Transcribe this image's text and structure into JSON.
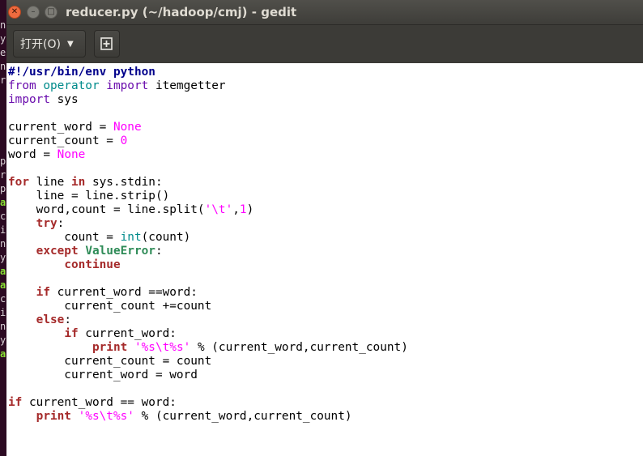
{
  "window": {
    "title": "reducer.py (~/hadoop/cmj) - gedit",
    "close_glyph": "✕",
    "min_glyph": "–",
    "max_glyph": "□"
  },
  "toolbar": {
    "open_label": "打开(O)",
    "open_caret": "▼"
  },
  "background_terminal": {
    "fragments": [
      "ne",
      "y",
      "er",
      "ne",
      "rt",
      "p",
      "r",
      "p",
      "ab",
      "co",
      "i",
      "n",
      "y",
      "ab",
      "ab",
      "co",
      "i",
      "n",
      "y",
      "ab"
    ]
  },
  "code": {
    "l1": "#!/usr/bin/env python",
    "l2_kw1": "from",
    "l2_mod": " operator ",
    "l2_kw2": "import",
    "l2_rest": " itemgetter",
    "l3_kw": "import",
    "l3_rest": " sys",
    "l5_a": "current_word = ",
    "l5_none": "None",
    "l6_a": "current_count = ",
    "l6_num": "0",
    "l7_a": "word = ",
    "l7_none": "None",
    "l9_for": "for",
    "l9_b": " line ",
    "l9_in": "in",
    "l9_c": " sys.stdin:",
    "l10": "    line = line.strip()",
    "l11_a": "    word,count = line.split(",
    "l11_str": "'\\t'",
    "l11_b": ",",
    "l11_num": "1",
    "l11_c": ")",
    "l12_kw": "try",
    "l12_c": ":",
    "l13_a": "        count = ",
    "l13_int": "int",
    "l13_b": "(count)",
    "l14_kw": "except",
    "l14_sp": " ",
    "l14_exc": "ValueError",
    "l14_c": ":",
    "l15_kw": "continue",
    "l17_kw": "if",
    "l17_b": " current_word ==word:",
    "l18": "        current_count +=count",
    "l19_kw": "else",
    "l19_c": ":",
    "l20_kw": "if",
    "l20_b": " current_word:",
    "l21_kw": "print",
    "l21_sp": " ",
    "l21_str": "'%s\\t%s'",
    "l21_b": " % (current_word,current_count)",
    "l22": "        current_count = count",
    "l23": "        current_word = word",
    "l25_kw": "if",
    "l25_b": " current_word == word:",
    "l26_kw": "print",
    "l26_sp": " ",
    "l26_str": "'%s\\t%s'",
    "l26_b": " % (current_word,current_count)"
  }
}
